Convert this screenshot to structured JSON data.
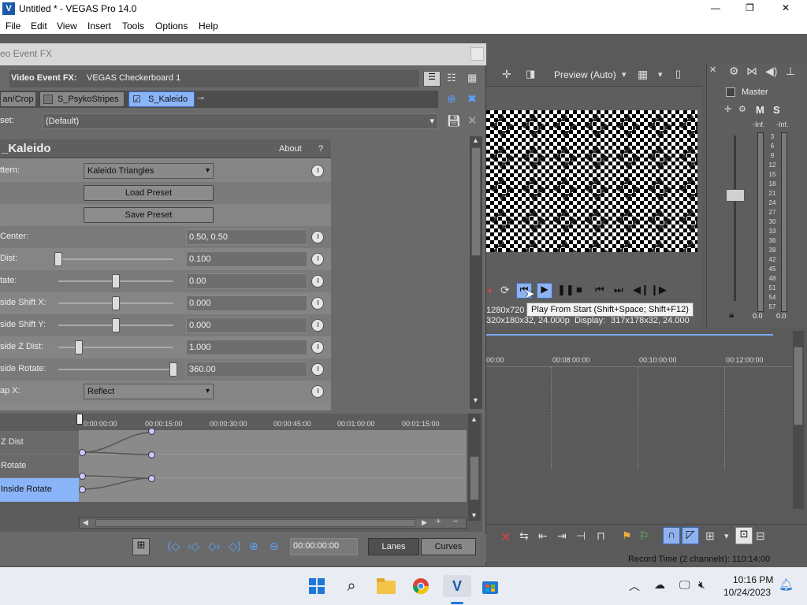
{
  "window": {
    "title": "Untitled * - VEGAS Pro 14.0",
    "minimize": "—",
    "maximize": "❐",
    "close": "✕"
  },
  "menu": [
    "File",
    "Edit",
    "View",
    "Insert",
    "Tools",
    "Options",
    "Help"
  ],
  "fx_dialog": {
    "title": "eo Event FX",
    "header_label": "Video Event FX:",
    "header_value": "VEGAS Checkerboard 1",
    "chain": [
      "an/Crop",
      "S_PsykoStripes",
      "S_Kaleido"
    ],
    "preset_label": "set:",
    "preset_value": "(Default)",
    "plugin_name": "_Kaleido",
    "about_label": "About",
    "help_label": "?",
    "params": [
      {
        "label": "ttern:",
        "type": "dropdown",
        "value": "Kaleido Triangles"
      },
      {
        "label": "",
        "type": "button",
        "value": "Load Preset"
      },
      {
        "label": "",
        "type": "button",
        "value": "Save Preset"
      },
      {
        "label": "Center:",
        "type": "field",
        "value": "0.50, 0.50"
      },
      {
        "label": "Dist:",
        "type": "slider",
        "value": "0.100",
        "pos": 0.0
      },
      {
        "label": "tate:",
        "type": "slider",
        "value": "0.00",
        "pos": 0.5
      },
      {
        "label": "side Shift X:",
        "type": "slider",
        "value": "0.000",
        "pos": 0.5
      },
      {
        "label": "side Shift Y:",
        "type": "slider",
        "value": "0.000",
        "pos": 0.5
      },
      {
        "label": "side Z Dist:",
        "type": "slider",
        "value": "1.000",
        "pos": 0.18
      },
      {
        "label": "side Rotate:",
        "type": "slider",
        "value": "360.00",
        "pos": 1.0
      },
      {
        "label": "ap X:",
        "type": "dropdown",
        "value": "Reflect"
      }
    ],
    "timeline_ticks": [
      "0:00:00:00",
      "00:00:15:00",
      "00:00:30:00",
      "00:00:45:00",
      "00:01:00:00",
      "00:01:15:00"
    ],
    "tracks": [
      "Z Dist",
      "Rotate",
      "Inside Rotate"
    ],
    "timecode": "00:00:00:00",
    "lanes_label": "Lanes",
    "curves_label": "Curves"
  },
  "preview": {
    "mode": "Preview (Auto)",
    "project": "1280x720",
    "preview_res": "320x180x32, 24.000p",
    "display_label": "Display:",
    "display_res": "317x178x32, 24.000"
  },
  "tooltip": "Play From Start (Shift+Space; Shift+F12)",
  "mixer": {
    "master": "Master",
    "m_label": "M",
    "s_label": "S",
    "inf_left": "-Inf.",
    "inf_right": "-Inf.",
    "scale": [
      "3",
      "6",
      "9",
      "12",
      "15",
      "18",
      "21",
      "24",
      "27",
      "30",
      "33",
      "36",
      "39",
      "42",
      "45",
      "48",
      "51",
      "54",
      "57"
    ],
    "level_left": "0.0",
    "level_right": "0.0"
  },
  "timeline_ticks": [
    "00:00",
    "00:08:00:00",
    "00:10:00:00",
    "00:12:00:00"
  ],
  "status": "Record Time (2 channels): 110:14:00",
  "clock": {
    "time": "10:16 PM",
    "date": "10/24/2023"
  },
  "colors": {
    "accent": "#78aaf0",
    "selected_track": "#8ab4f8",
    "preview_bg": "#ffffff"
  }
}
